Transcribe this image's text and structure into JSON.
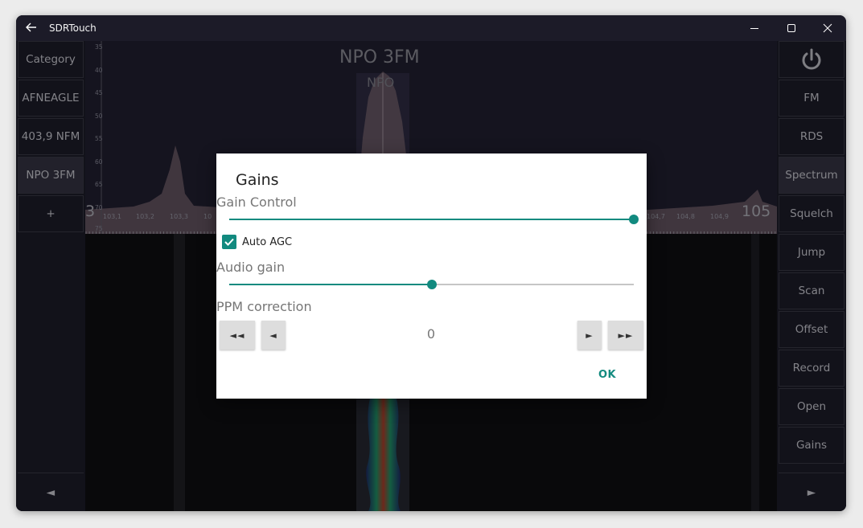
{
  "window": {
    "title": "SDRTouch"
  },
  "left_panel": {
    "items": [
      "Category",
      "AFNEAGLE",
      "403,9 NFM",
      "NPO 3FM",
      "+"
    ],
    "bottom_arrow": "◄"
  },
  "right_panel": {
    "power_icon": "power-icon",
    "items": [
      "FM",
      "RDS",
      "Spectrum",
      "Squelch",
      "Jump",
      "Scan",
      "Offset",
      "Record",
      "Open",
      "Gains"
    ],
    "active_item": "Spectrum",
    "bottom_arrow": "►"
  },
  "spectrum": {
    "station_name": "NPO 3FM",
    "station_ps": "NPO",
    "db_scale": [
      "35",
      "40",
      "45",
      "50",
      "55",
      "60",
      "65",
      "70",
      "75"
    ],
    "freq_labels_left": [
      "103,1",
      "103,2",
      "103,3",
      "10"
    ],
    "freq_labels_right": [
      "104,7",
      "104,8",
      "104,9"
    ],
    "big_freq_left": "3",
    "big_freq_right": "105"
  },
  "dialog": {
    "title": "Gains",
    "gain_control_label": "Gain Control",
    "gain_control_value": 1.0,
    "auto_agc_label": "Auto AGC",
    "auto_agc_checked": true,
    "audio_gain_label": "Audio gain",
    "audio_gain_value": 0.5,
    "ppm_label": "PPM correction",
    "ppm_value": "0",
    "ppm_buttons": {
      "fast_back": "◄◄",
      "back": "◄",
      "forward": "►",
      "fast_forward": "►►"
    },
    "ok_label": "OK"
  },
  "colors": {
    "accent": "#128a7f",
    "panel_bg": "#1d1c29",
    "spectrum_bg": "#211f31"
  }
}
